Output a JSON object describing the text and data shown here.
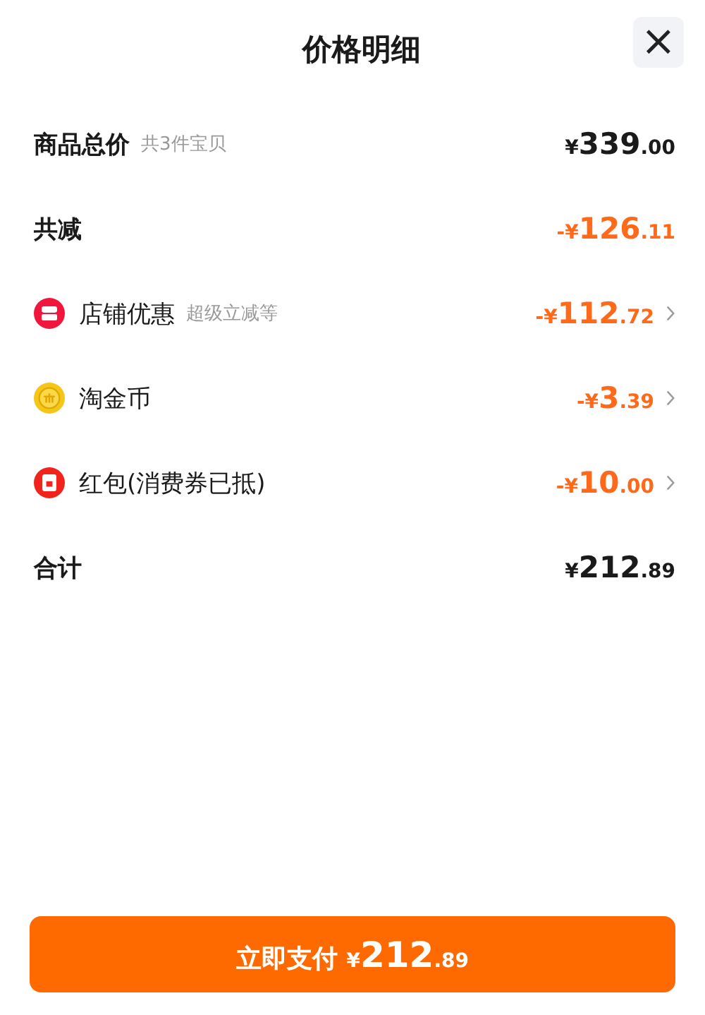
{
  "title": "价格明细",
  "close": "×",
  "rows": [
    {
      "kind": "summary",
      "label": "商品总价",
      "note": "共3件宝贝",
      "amount": "¥339.00",
      "highlighted": false
    },
    {
      "kind": "summary",
      "label": "共减",
      "amount": "-¥126.11",
      "highlighted": true
    },
    {
      "kind": "store",
      "label": "店铺优惠",
      "note": "超级立减等",
      "amount": "-¥112.72",
      "highlighted": true
    },
    {
      "kind": "coin",
      "label": "淘金币",
      "amount": "-¥3.39",
      "highlighted": true
    },
    {
      "kind": "packet",
      "label": "红包(消费券已抵)",
      "amount": "-¥10.00",
      "highlighted": true
    },
    {
      "kind": "summary",
      "label": "合计",
      "amount": "¥212.89",
      "highlighted": false
    }
  ],
  "pay_button": {
    "label": "立即支付",
    "amount": "¥212.89"
  }
}
